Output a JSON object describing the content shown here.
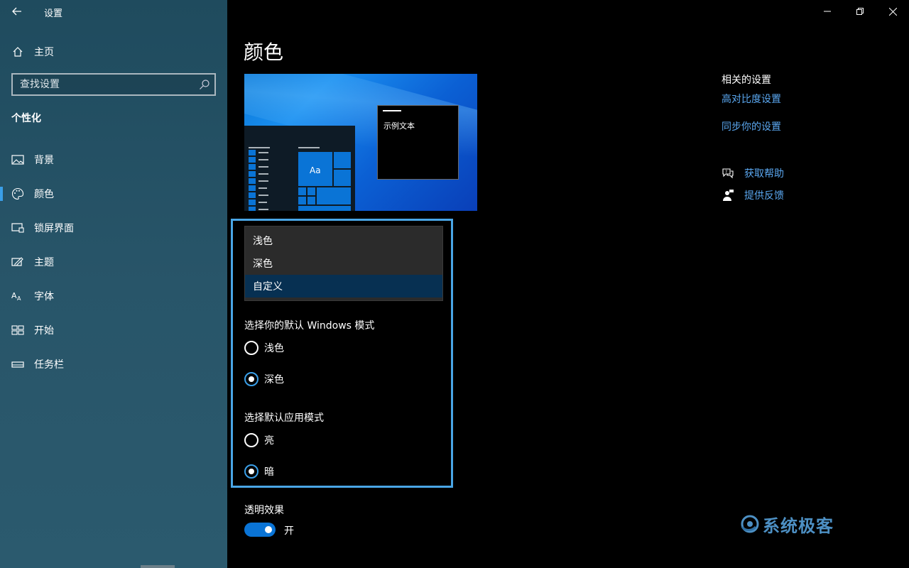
{
  "app": {
    "title": "设置"
  },
  "sidebar": {
    "home_label": "主页",
    "search_placeholder": "查找设置",
    "section_title": "个性化",
    "items": [
      {
        "label": "背景",
        "icon": "picture-icon"
      },
      {
        "label": "颜色",
        "icon": "palette-icon",
        "selected": true
      },
      {
        "label": "锁屏界面",
        "icon": "lock-screen-icon"
      },
      {
        "label": "主题",
        "icon": "theme-brush-icon"
      },
      {
        "label": "字体",
        "icon": "font-icon"
      },
      {
        "label": "开始",
        "icon": "start-icon"
      },
      {
        "label": "任务栏",
        "icon": "taskbar-icon"
      }
    ]
  },
  "main": {
    "title": "颜色",
    "preview": {
      "sample_text": "示例文本",
      "tile_text": "Aa"
    },
    "color_dropdown": {
      "options": [
        "浅色",
        "深色",
        "自定义"
      ],
      "selected": "自定义"
    },
    "windows_mode": {
      "label": "选择你的默认 Windows 模式",
      "options": [
        "浅色",
        "深色"
      ],
      "selected": "深色"
    },
    "app_mode": {
      "label": "选择默认应用模式",
      "options": [
        "亮",
        "暗"
      ],
      "selected": "暗"
    },
    "transparency": {
      "label": "透明效果",
      "state": "开",
      "on": true
    }
  },
  "related": {
    "title": "相关的设置",
    "links": [
      "高对比度设置",
      "同步你的设置"
    ],
    "help": [
      {
        "label": "获取帮助",
        "icon": "help-chat-icon"
      },
      {
        "label": "提供反馈",
        "icon": "feedback-icon"
      }
    ]
  },
  "watermark": {
    "text": "系统极客"
  },
  "colors": {
    "accent": "#0a74d6",
    "link": "#5aa7f0",
    "highlight_border": "#4aa6e6",
    "sidebar": "#285569"
  }
}
